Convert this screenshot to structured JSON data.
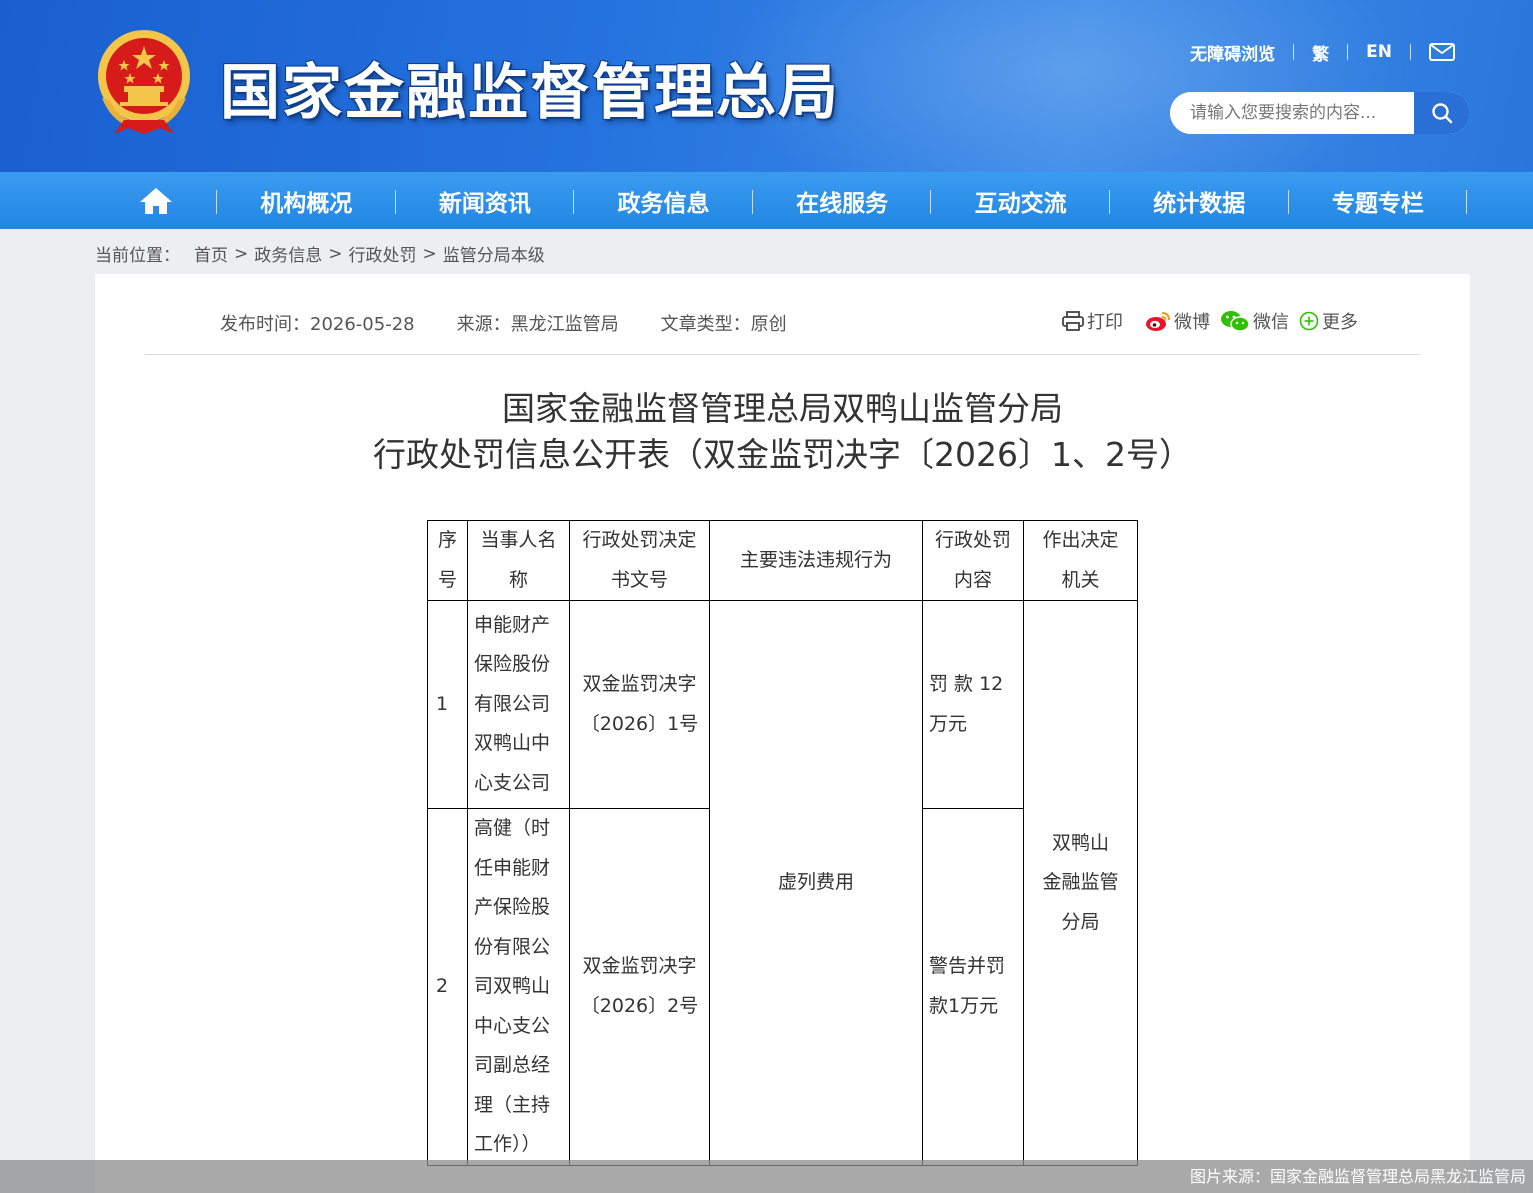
{
  "header": {
    "site_title": "国家金融监督管理总局",
    "top_links": [
      "无障碍浏览",
      "繁",
      "EN"
    ],
    "search_placeholder": "请输入您要搜索的内容...",
    "colors": {
      "header_blue": "#2573de",
      "nav_blue": "#2186e4",
      "emblem_red": "#d71a1a",
      "emblem_gold": "#f3c64a"
    }
  },
  "nav": {
    "items": [
      "机构概况",
      "新闻资讯",
      "政务信息",
      "在线服务",
      "互动交流",
      "统计数据",
      "专题专栏"
    ]
  },
  "breadcrumb": {
    "prefix": "当前位置：",
    "items": [
      "首页",
      "政务信息",
      "行政处罚",
      "监管分局本级"
    ],
    "separator": ">"
  },
  "meta": {
    "publish_time": "发布时间：2026-05-28",
    "source": "来源：黑龙江监管局",
    "type": "文章类型：原创"
  },
  "share": {
    "print": "打印",
    "weibo": "微博",
    "wechat": "微信",
    "more": "更多"
  },
  "article": {
    "title_line1": "国家金融监督管理总局双鸭山监管分局",
    "title_line2": "行政处罚信息公开表（双金监罚决字〔2026〕1、2号）"
  },
  "table": {
    "headers": [
      [
        "序",
        "号"
      ],
      [
        "当事人名",
        "称"
      ],
      [
        "行政处罚决定",
        "书文号"
      ],
      [
        "主要违法违规行为"
      ],
      [
        "行政处罚",
        "内容"
      ],
      [
        "作出决定",
        "机关"
      ]
    ],
    "rows": [
      {
        "index": "1",
        "party": [
          "申能财产",
          "保险股份",
          "有限公司",
          "双鸭山中",
          "心支公司"
        ],
        "doc_no": [
          "双金监罚决字",
          "〔2026〕1号"
        ],
        "penalty": [
          "罚 款 12",
          "万元"
        ]
      },
      {
        "index": "2",
        "party": [
          "高健（时",
          "任申能财",
          "产保险股",
          "份有限公",
          "司双鸭山",
          "中心支公",
          "司副总经",
          "理（主持",
          "工作））"
        ],
        "doc_no": [
          "双金监罚决字",
          "〔2026〕2号"
        ],
        "penalty": [
          "警告并罚",
          "款1万元"
        ]
      }
    ],
    "violation": "虚列费用",
    "authority": [
      "双鸭山",
      "金融监管",
      "分局"
    ]
  },
  "caption": "图片来源：国家金融监督管理总局黑龙江监管局"
}
